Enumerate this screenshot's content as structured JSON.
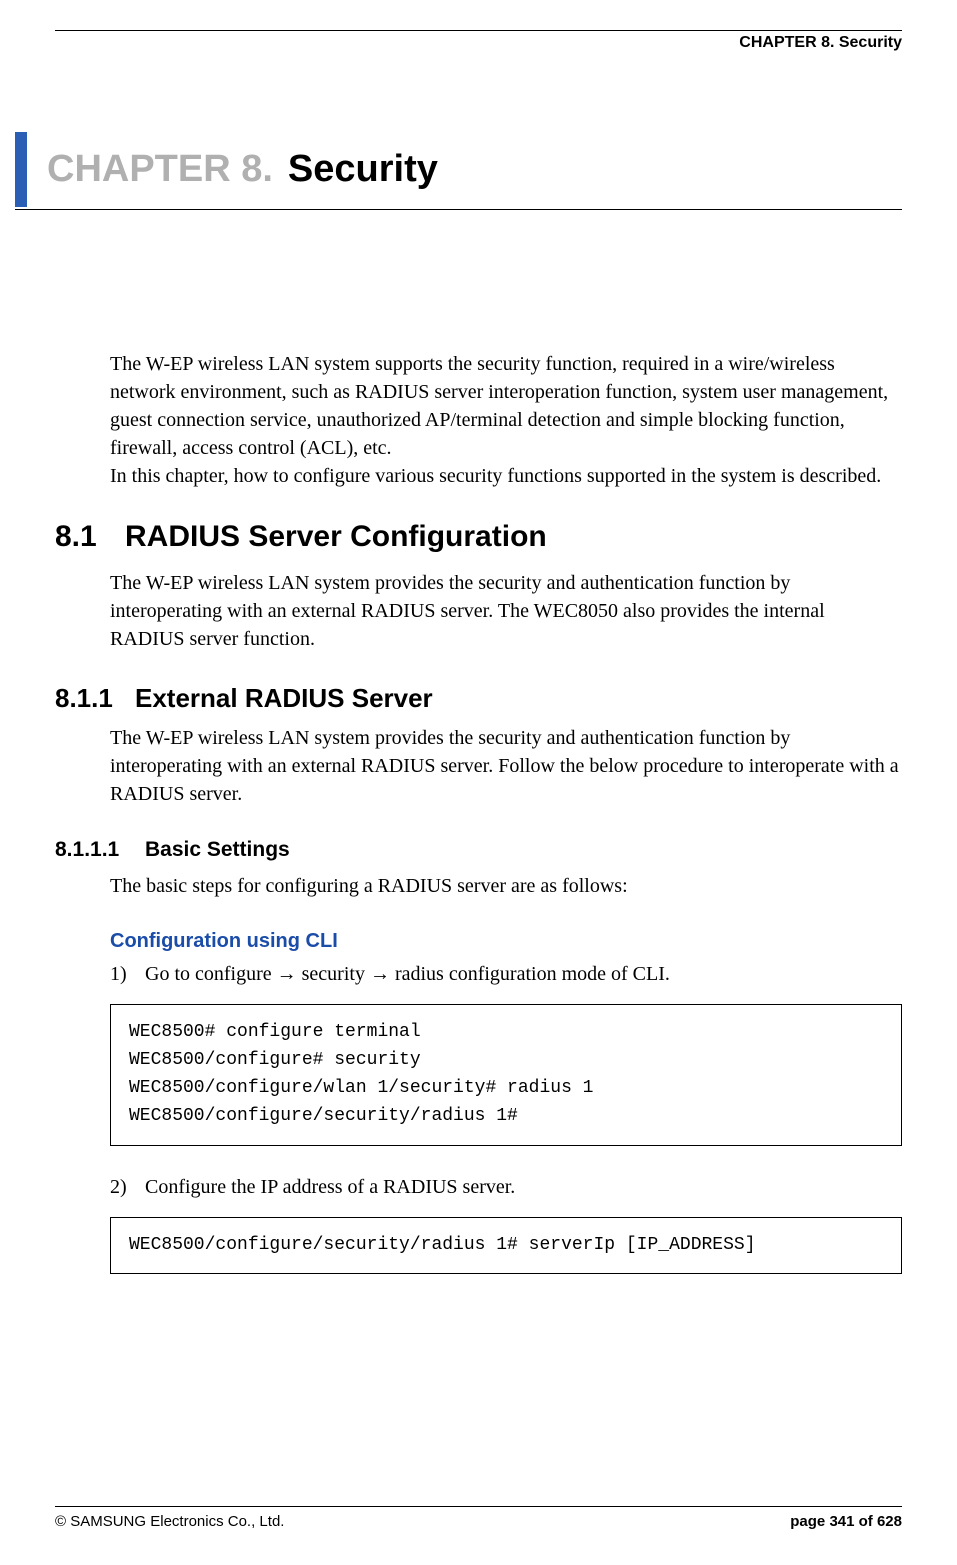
{
  "header": "CHAPTER 8. Security",
  "chapter": {
    "prefix": "CHAPTER 8.",
    "title": "Security"
  },
  "intro": "The W-EP wireless LAN system supports the security function, required in a wire/wireless network environment, such as RADIUS server interoperation function, system user management, guest connection service, unauthorized AP/terminal detection and simple blocking function, firewall, access control (ACL), etc.\nIn this chapter, how to configure various security functions supported in the system is described.",
  "sections": {
    "s8_1": {
      "num": "8.1",
      "title": "RADIUS Server Configuration",
      "body": "The W-EP wireless LAN system provides the security and authentication function by interoperating with an external RADIUS server. The WEC8050 also provides the internal RADIUS server function."
    },
    "s8_1_1": {
      "num": "8.1.1",
      "title": "External RADIUS Server",
      "body": "The W-EP wireless LAN system provides the security and authentication function by interoperating with an external RADIUS server. Follow the below procedure to interoperate with a RADIUS server."
    },
    "s8_1_1_1": {
      "num": "8.1.1.1",
      "title": "Basic Settings",
      "body": "The basic steps for configuring a RADIUS server are as follows:"
    }
  },
  "cli": {
    "heading": "Configuration using CLI",
    "step1": {
      "num": "1)",
      "pre": "Go to configure ",
      "mid": " security ",
      "post": " radius configuration mode of CLI."
    },
    "code1": "WEC8500# configure terminal\nWEC8500/configure# security\nWEC8500/configure/wlan 1/security# radius 1\nWEC8500/configure/security/radius 1#",
    "step2": {
      "num": "2)",
      "text": "Configure the IP address of a RADIUS server."
    },
    "code2": "WEC8500/configure/security/radius 1# serverIp [IP_ADDRESS]"
  },
  "footer": {
    "left": "© SAMSUNG Electronics Co., Ltd.",
    "right": "page 341 of 628"
  },
  "glyphs": {
    "arrow": "→"
  }
}
